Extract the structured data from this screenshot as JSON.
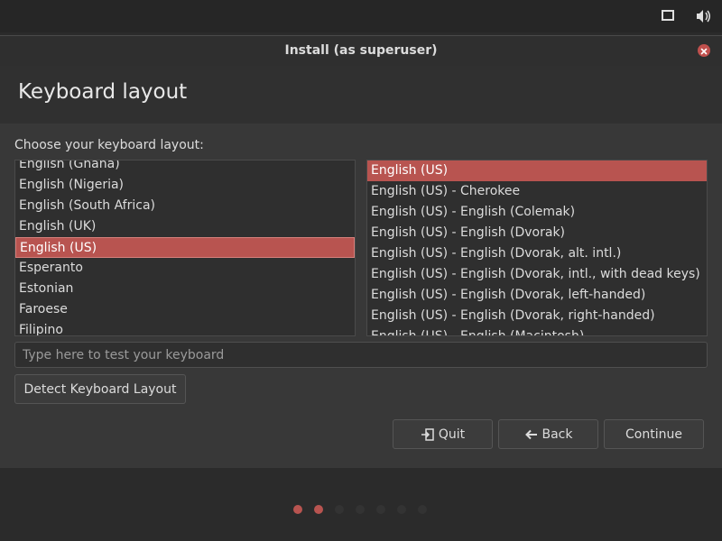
{
  "tray": {
    "icons": [
      "display-icon",
      "volume-icon"
    ]
  },
  "window": {
    "title": "Install (as superuser)"
  },
  "page": {
    "title": "Keyboard layout",
    "prompt": "Choose your keyboard layout:"
  },
  "layouts": {
    "items": [
      "English (Ghana)",
      "English (Nigeria)",
      "English (South Africa)",
      "English (UK)",
      "English (US)",
      "Esperanto",
      "Estonian",
      "Faroese",
      "Filipino"
    ],
    "selected": "English (US)"
  },
  "variants": {
    "items": [
      "English (US)",
      "English (US) - Cherokee",
      "English (US) - English (Colemak)",
      "English (US) - English (Dvorak)",
      "English (US) - English (Dvorak, alt. intl.)",
      "English (US) - English (Dvorak, intl., with dead keys)",
      "English (US) - English (Dvorak, left-handed)",
      "English (US) - English (Dvorak, right-handed)",
      "English (US) - English (Macintosh)"
    ],
    "selected": "English (US)"
  },
  "test_field": {
    "placeholder": "Type here to test your keyboard",
    "value": ""
  },
  "buttons": {
    "detect": "Detect Keyboard Layout",
    "quit": "Quit",
    "back": "Back",
    "continue": "Continue"
  },
  "progress": {
    "total_steps": 7,
    "completed_steps": 2
  },
  "colors": {
    "accent": "#b85450",
    "background": "#383838",
    "panel": "#262626"
  }
}
